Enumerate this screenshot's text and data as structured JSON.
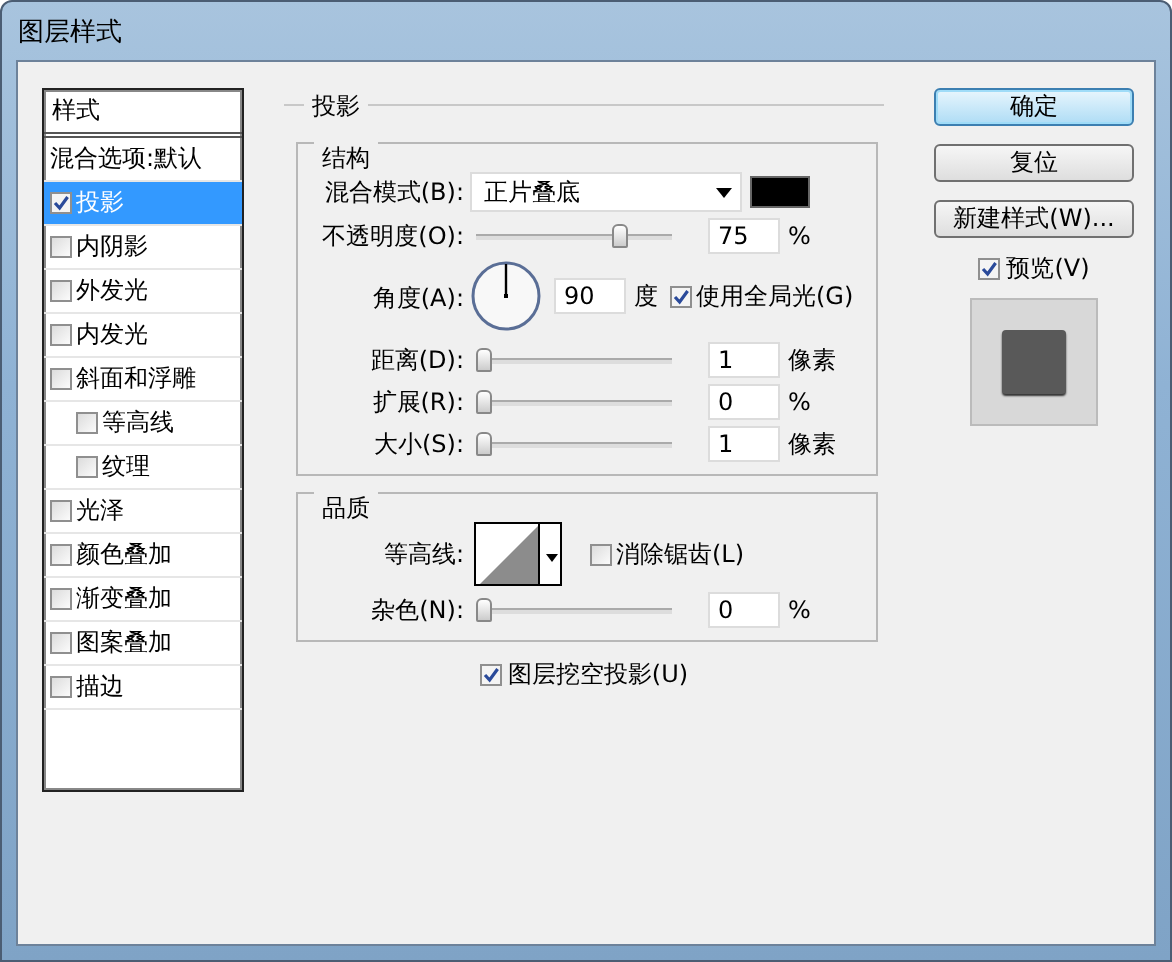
{
  "window": {
    "title": "图层样式"
  },
  "styles_list": {
    "header": "样式",
    "items": [
      {
        "label": "混合选项:默认",
        "kind": "plain",
        "selected": false
      },
      {
        "label": "投影",
        "kind": "check",
        "checked": true,
        "selected": true
      },
      {
        "label": "内阴影",
        "kind": "check",
        "checked": false,
        "selected": false
      },
      {
        "label": "外发光",
        "kind": "check",
        "checked": false,
        "selected": false
      },
      {
        "label": "内发光",
        "kind": "check",
        "checked": false,
        "selected": false
      },
      {
        "label": "斜面和浮雕",
        "kind": "check",
        "checked": false,
        "selected": false,
        "children": [
          {
            "label": "等高线",
            "kind": "check",
            "checked": false,
            "selected": false
          },
          {
            "label": "纹理",
            "kind": "check",
            "checked": false,
            "selected": false
          }
        ]
      },
      {
        "label": "光泽",
        "kind": "check",
        "checked": false,
        "selected": false
      },
      {
        "label": "颜色叠加",
        "kind": "check",
        "checked": false,
        "selected": false
      },
      {
        "label": "渐变叠加",
        "kind": "check",
        "checked": false,
        "selected": false
      },
      {
        "label": "图案叠加",
        "kind": "check",
        "checked": false,
        "selected": false
      },
      {
        "label": "描边",
        "kind": "check",
        "checked": false,
        "selected": false
      }
    ]
  },
  "drop_shadow": {
    "title": "投影",
    "structure": {
      "title": "结构",
      "rows": [
        {
          "kind": "select",
          "label": "混合模式(B):",
          "value": "正片叠底",
          "color": "#000000"
        },
        {
          "kind": "slider",
          "label": "不透明度(O):",
          "level": 0.75,
          "value": "75",
          "unit": "%"
        },
        {
          "kind": "angle",
          "label": "角度(A):",
          "value": "90",
          "unit": "度",
          "option": {
            "label": "使用全局光(G)",
            "checked": true
          }
        },
        {
          "kind": "slider",
          "label": "距离(D):",
          "level": 0,
          "value": "1",
          "unit": "像素"
        },
        {
          "kind": "slider",
          "label": "扩展(R):",
          "level": 0,
          "value": "0",
          "unit": "%"
        },
        {
          "kind": "slider",
          "label": "大小(S):",
          "level": 0,
          "value": "1",
          "unit": "像素"
        }
      ]
    },
    "quality": {
      "title": "品质",
      "rows": [
        {
          "kind": "contour",
          "label": "等高线:",
          "option": {
            "label": "消除锯齿(L)",
            "checked": false
          }
        },
        {
          "kind": "slider",
          "label": "杂色(N):",
          "level": 0,
          "value": "0",
          "unit": "%"
        }
      ]
    },
    "knockout": {
      "label": "图层挖空投影(U)",
      "checked": true
    }
  },
  "buttons": [
    {
      "label": "确定",
      "default": true
    },
    {
      "label": "复位",
      "default": false
    },
    {
      "label": "新建样式(W)...",
      "default": false
    }
  ],
  "preview": {
    "label": "预览(V)",
    "checked": true
  }
}
